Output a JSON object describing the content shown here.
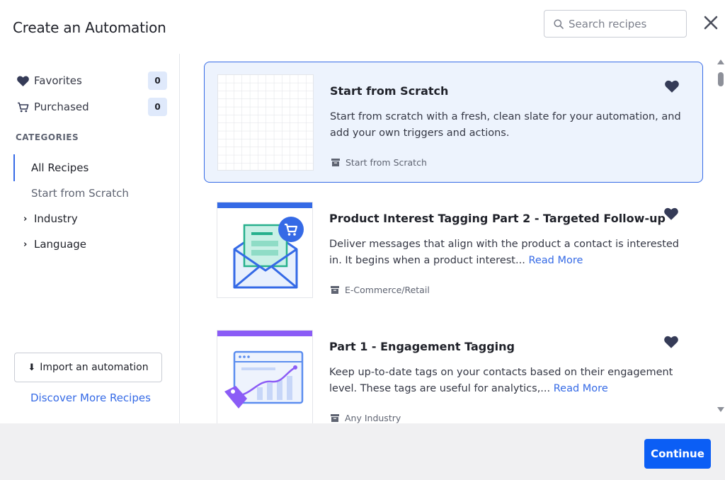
{
  "header": {
    "title": "Create an Automation",
    "search_placeholder": "Search recipes"
  },
  "sidebar": {
    "favorites": {
      "label": "Favorites",
      "count": "0"
    },
    "purchased": {
      "label": "Purchased",
      "count": "0"
    },
    "categories_heading": "CATEGORIES",
    "categories": [
      {
        "label": "All Recipes",
        "active": true
      },
      {
        "label": "Start from Scratch",
        "active": false
      }
    ],
    "expandable": [
      {
        "label": "Industry"
      },
      {
        "label": "Language"
      }
    ],
    "import_label": "Import an automation",
    "discover_label": "Discover More Recipes"
  },
  "recipes": [
    {
      "title": "Start from Scratch",
      "description": "Start from scratch with a fresh, clean slate for your automation, and add your own triggers and actions.",
      "read_more": "",
      "tag": "Start from Scratch",
      "selected": true,
      "thumbnail": "grid-icon"
    },
    {
      "title": "Product Interest Tagging Part 2 - Targeted Follow-up",
      "description": "Deliver messages that align with the product a contact is interested in. It begins when a product interest...",
      "read_more": "Read More",
      "tag": "E-Commerce/Retail",
      "selected": false,
      "thumbnail": "email-cart-icon"
    },
    {
      "title": "Part 1 - Engagement Tagging",
      "description": "Keep up-to-date tags on your contacts based on their engagement level. These tags are useful for analytics,...",
      "read_more": "Read More",
      "tag": "Any Industry",
      "selected": false,
      "thumbnail": "chart-tag-icon"
    }
  ],
  "footer": {
    "continue_label": "Continue"
  },
  "colors": {
    "accent": "#356ae6",
    "primary_button": "#0b5ef5",
    "selected_card_bg": "#edf3fd",
    "badge_bg": "#dfe9fb",
    "heart": "#353b57"
  }
}
